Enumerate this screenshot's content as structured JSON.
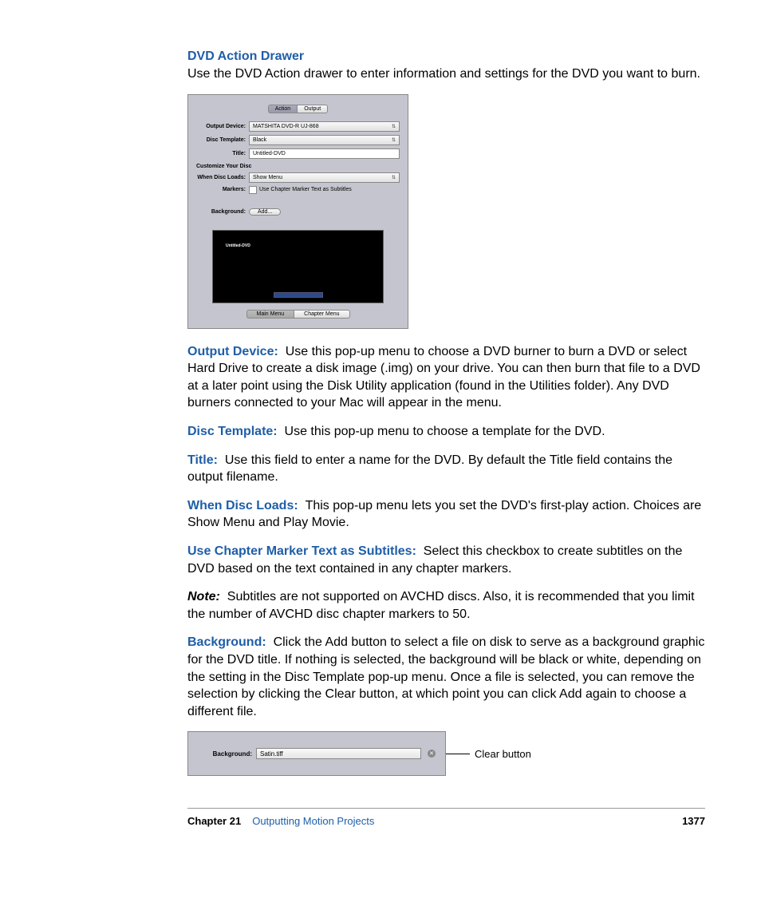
{
  "section_title": "DVD Action Drawer",
  "intro": "Use the DVD Action drawer to enter information and settings for the DVD you want to burn.",
  "drawer": {
    "tabs": {
      "action": "Action",
      "output": "Output"
    },
    "output_device": {
      "label": "Output Device:",
      "value": "MATSHITA DVD-R   UJ-868"
    },
    "disc_template": {
      "label": "Disc Template:",
      "value": "Black"
    },
    "title": {
      "label": "Title:",
      "value": "Untitled-DVD"
    },
    "customize_header": "Customize Your Disc",
    "when_disc_loads": {
      "label": "When Disc Loads:",
      "value": "Show Menu"
    },
    "markers": {
      "label": "Markers:",
      "text": "Use Chapter Marker Text as Subtitles"
    },
    "background": {
      "label": "Background:",
      "button": "Add..."
    },
    "preview_label": "Untitled-DVD",
    "menu_tabs": {
      "main": "Main Menu",
      "chapter": "Chapter Menu"
    }
  },
  "defs": {
    "output_device": {
      "term": "Output Device:",
      "text": "Use this pop-up menu to choose a DVD burner to burn a DVD or select Hard Drive to create a disk image (.img) on your drive. You can then burn that file to a DVD at a later point using the Disk Utility application (found in the Utilities folder). Any DVD burners connected to your Mac will appear in the menu."
    },
    "disc_template": {
      "term": "Disc Template:",
      "text": "Use this pop-up menu to choose a template for the DVD."
    },
    "title": {
      "term": "Title:",
      "text": "Use this field to enter a name for the DVD. By default the Title field contains the output filename."
    },
    "when_disc_loads": {
      "term": "When Disc Loads:",
      "text": "This pop-up menu lets you set the DVD's first-play action. Choices are Show Menu and Play Movie."
    },
    "use_chapter": {
      "term": "Use Chapter Marker Text as Subtitles:",
      "text": "Select this checkbox to create subtitles on the DVD based on the text contained in any chapter markers."
    },
    "note": {
      "label": "Note:",
      "text": "Subtitles are not supported on AVCHD discs. Also, it is recommended that you limit the number of AVCHD disc chapter markers to 50."
    },
    "background": {
      "term": "Background:",
      "text": "Click the Add button to select a file on disk to serve as a background graphic for the DVD title. If nothing is selected, the background will be black or white, depending on the setting in the Disc Template pop-up menu. Once a file is selected, you can remove the selection by clicking the Clear button, at which point you can click Add again to choose a different file."
    }
  },
  "bg_panel": {
    "label": "Background:",
    "value": "Satin.tiff",
    "callout": "Clear button"
  },
  "footer": {
    "chapter": "Chapter 21",
    "title": "Outputting Motion Projects",
    "page": "1377"
  }
}
